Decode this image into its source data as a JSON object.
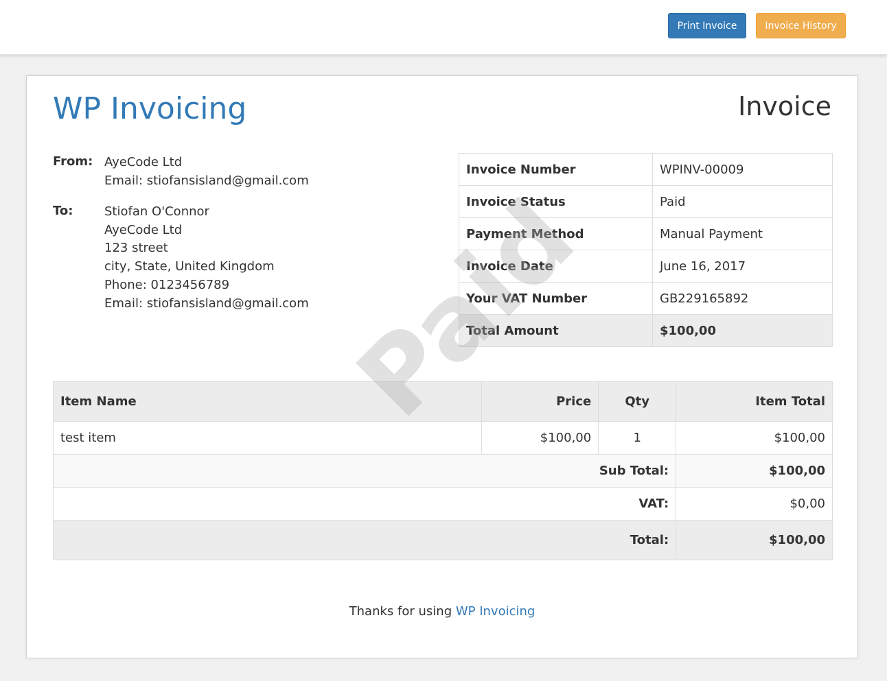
{
  "toolbar": {
    "print_label": "Print Invoice",
    "history_label": "Invoice History",
    "print_color": "#337ab7",
    "history_color": "#f0ad4e"
  },
  "invoice": {
    "brand": "WP Invoicing",
    "title": "Invoice",
    "watermark": "Paid",
    "from": {
      "label": "From:",
      "lines": [
        "AyeCode Ltd",
        "Email: stiofansisland@gmail.com"
      ]
    },
    "to": {
      "label": "To:",
      "lines": [
        "Stiofan O'Connor",
        "AyeCode Ltd",
        "123 street",
        "city, State, United Kingdom",
        "Phone: 0123456789",
        "Email: stiofansisland@gmail.com"
      ]
    },
    "meta": [
      {
        "label": "Invoice Number",
        "value": "WPINV-00009"
      },
      {
        "label": "Invoice Status",
        "value": "Paid"
      },
      {
        "label": "Payment Method",
        "value": "Manual Payment"
      },
      {
        "label": "Invoice Date",
        "value": "June 16, 2017"
      },
      {
        "label": "Your VAT Number",
        "value": "GB229165892"
      },
      {
        "label": "Total Amount",
        "value": "$100,00"
      }
    ],
    "items_table": {
      "headers": {
        "name": "Item Name",
        "price": "Price",
        "qty": "Qty",
        "total": "Item Total"
      },
      "rows": [
        {
          "name": "test item",
          "price": "$100,00",
          "qty": "1",
          "total": "$100,00"
        }
      ],
      "subtotal": {
        "label": "Sub Total:",
        "value": "$100,00"
      },
      "vat": {
        "label": "VAT:",
        "value": "$0,00"
      },
      "total": {
        "label": "Total:",
        "value": "$100,00"
      }
    },
    "footer": {
      "text": "Thanks for using ",
      "link": "WP Invoicing"
    }
  }
}
